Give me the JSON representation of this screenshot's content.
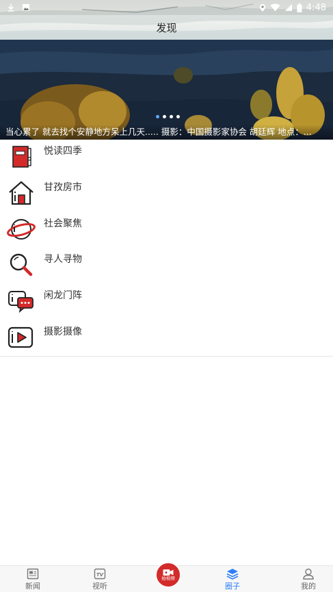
{
  "status_bar": {
    "time": "4:48"
  },
  "header": {
    "title": "发现"
  },
  "banner": {
    "caption": "当心累了 就去找个安静地方呆上几天.....  摄影：中国摄影家协会 胡廷辉 地点：..."
  },
  "list": [
    {
      "label": "悦读四季",
      "icon": "book-icon"
    },
    {
      "label": "甘孜房市",
      "icon": "house-icon"
    },
    {
      "label": "社会聚焦",
      "icon": "planet-icon"
    },
    {
      "label": "寻人寻物",
      "icon": "magnifier-icon"
    },
    {
      "label": "闲龙门阵",
      "icon": "chat-bubbles-icon"
    },
    {
      "label": "摄影摄像",
      "icon": "video-play-icon"
    }
  ],
  "bottom_nav": {
    "news": "新闻",
    "video": "视听",
    "center": "拍视频",
    "circle": "圈子",
    "me": "我的"
  },
  "colors": {
    "accent": "#2d7ff9",
    "icon_red": "#d32a2a"
  }
}
